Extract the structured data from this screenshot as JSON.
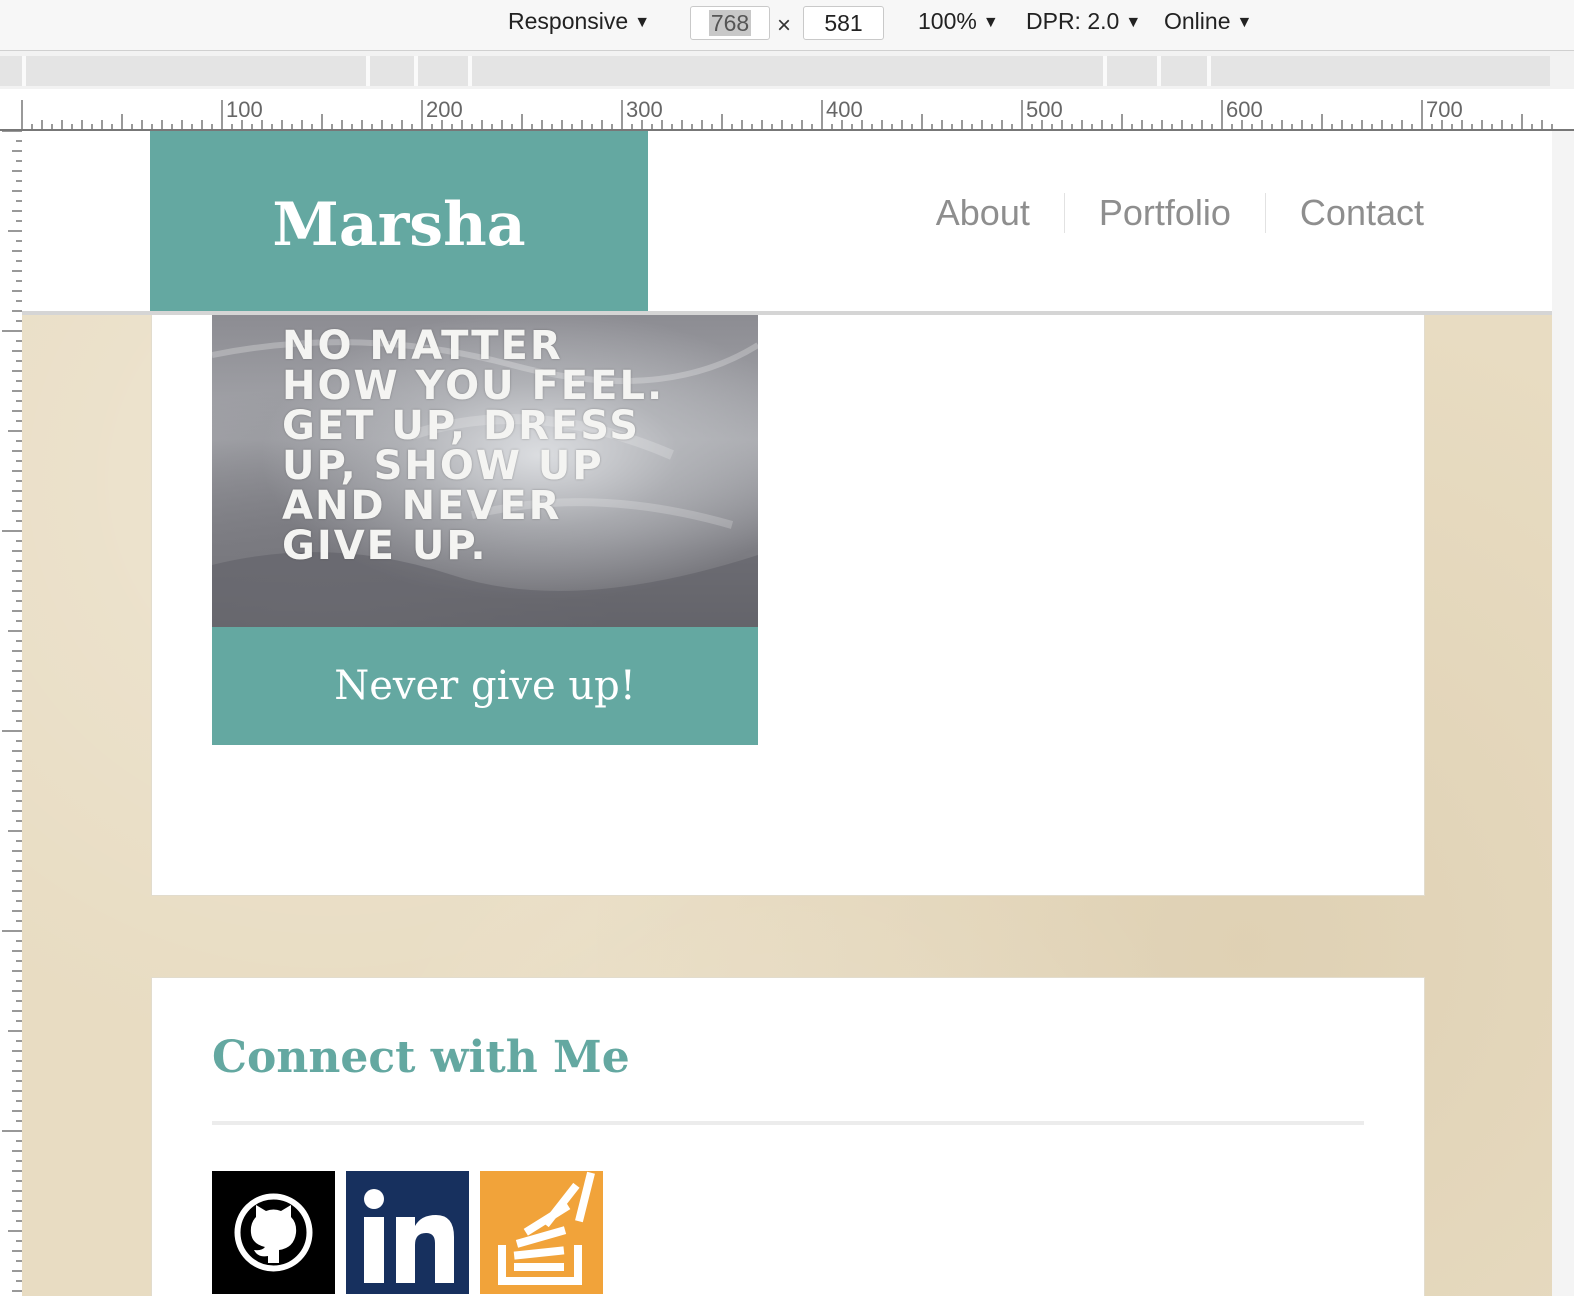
{
  "devtools": {
    "device": "Responsive",
    "width": "768",
    "height": "581",
    "zoom": "100%",
    "dpr": "DPR: 2.0",
    "network": "Online",
    "ruler_labels": [
      "100",
      "200",
      "300",
      "400",
      "500",
      "600",
      "700"
    ]
  },
  "site": {
    "logo": "Marsha",
    "nav": [
      "About",
      "Portfolio",
      "Contact"
    ],
    "quote_image_lines": [
      "NO MATTER",
      "HOW YOU FEEL.",
      "GET UP, DRESS",
      "UP, SHOW UP",
      "AND NEVER",
      "GIVE UP."
    ],
    "quote_caption": "Never give up!",
    "connect_title": "Connect with Me",
    "social_links": [
      {
        "icon": "github-icon"
      },
      {
        "icon": "linkedin-icon"
      },
      {
        "icon": "stackoverflow-icon"
      }
    ]
  },
  "colors": {
    "brand": "#64a8a1",
    "page_background": "#e8dcc2",
    "nav_text": "#8e8e8e",
    "github": "#000000",
    "linkedin": "#17305e",
    "stackoverflow": "#f1a33a"
  }
}
